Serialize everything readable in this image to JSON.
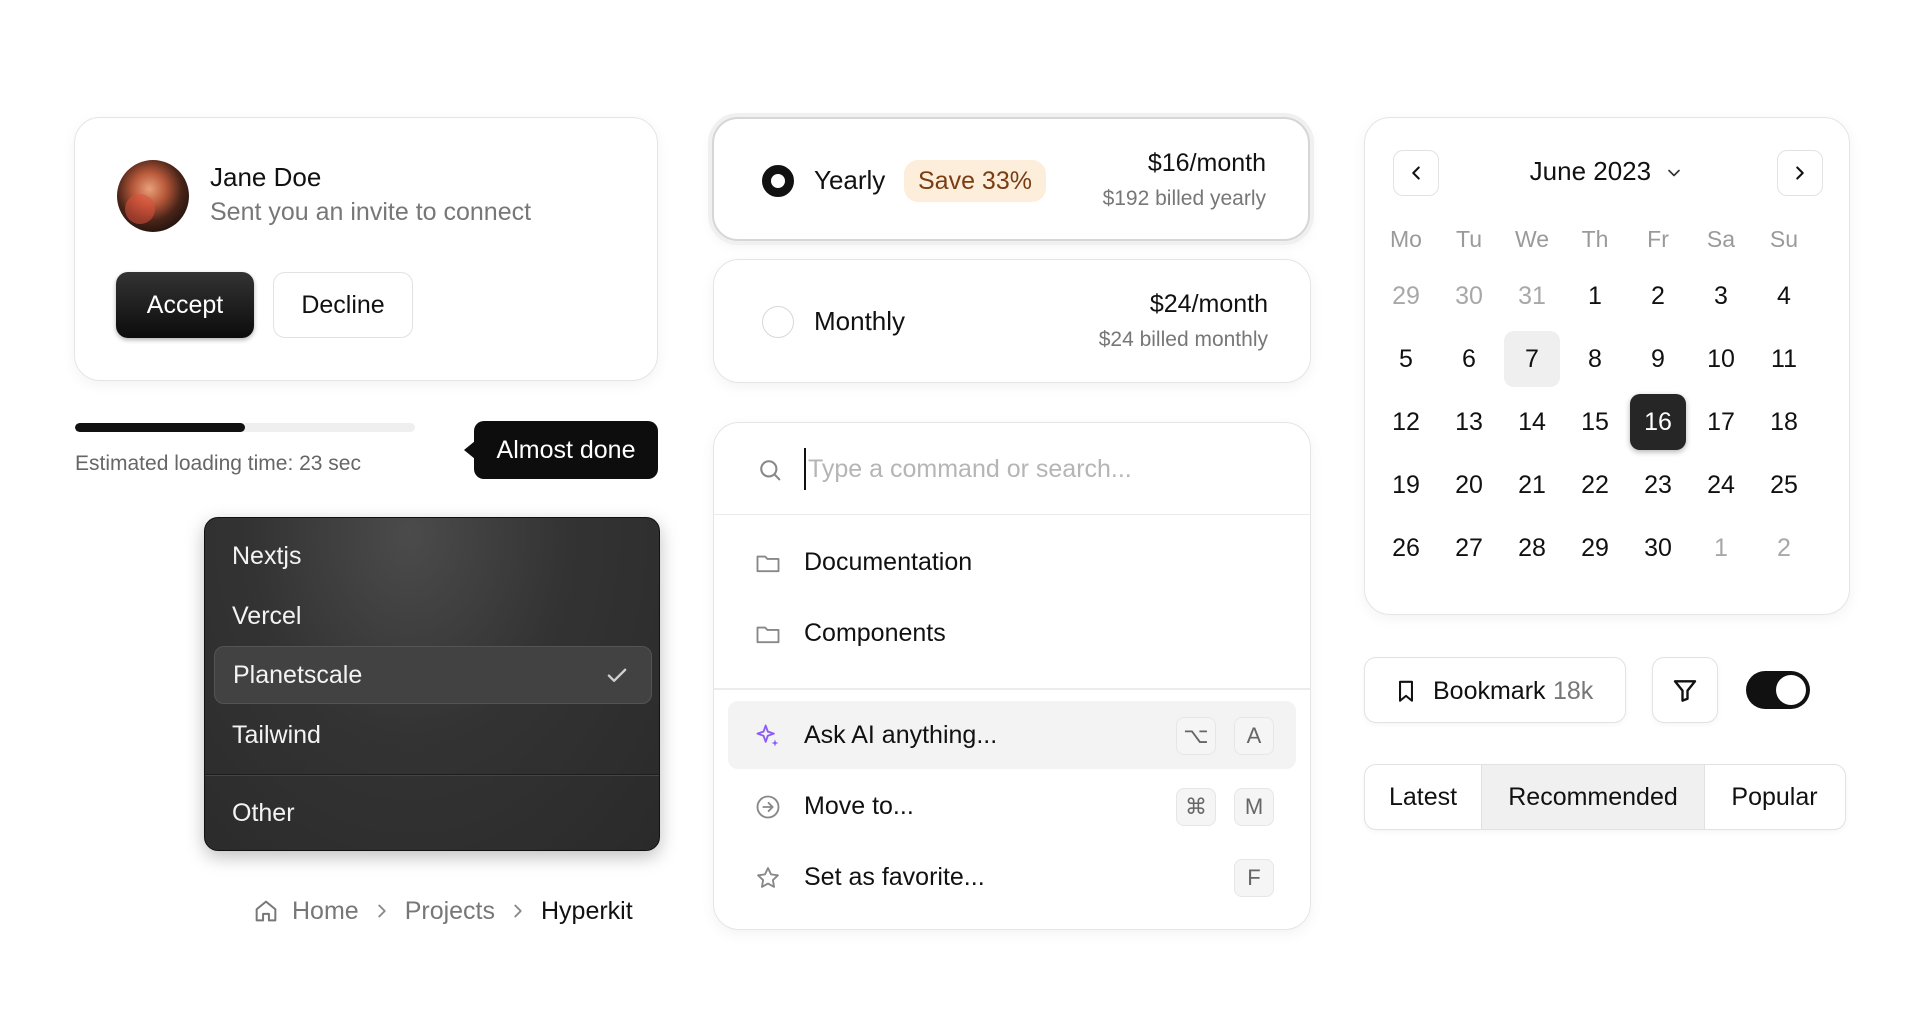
{
  "invite": {
    "name": "Jane Doe",
    "message": "Sent you an invite to connect",
    "accept_label": "Accept",
    "decline_label": "Decline"
  },
  "progress": {
    "value": 0.5,
    "text": "Estimated loading time: 23 sec",
    "tooltip": "Almost done"
  },
  "dropdown": {
    "items": [
      "Nextjs",
      "Vercel",
      "Planetscale",
      "Tailwind",
      "Other"
    ],
    "selected": "Planetscale"
  },
  "breadcrumb": {
    "items": [
      "Home",
      "Projects",
      "Hyperkit"
    ]
  },
  "plans": {
    "yearly": {
      "name": "Yearly",
      "badge": "Save 33%",
      "price": "$16",
      "per": "/month",
      "billed": "$192 billed yearly",
      "selected": true
    },
    "monthly": {
      "name": "Monthly",
      "price": "$24",
      "per": "/month",
      "billed": "$24 billed monthly",
      "selected": false
    }
  },
  "palette": {
    "placeholder": "Type a command or search...",
    "items": [
      {
        "label": "Documentation",
        "icon": "folder-icon"
      },
      {
        "label": "Components",
        "icon": "folder-icon"
      },
      {
        "label": "Ask AI anything...",
        "icon": "sparkles-icon",
        "keys": [
          "⌥",
          "A"
        ]
      },
      {
        "label": "Move to...",
        "icon": "arrow-circle-icon",
        "keys": [
          "⌘",
          "M"
        ]
      },
      {
        "label": "Set as favorite...",
        "icon": "star-icon",
        "keys": [
          "F"
        ]
      }
    ]
  },
  "calendar": {
    "title": "June 2023",
    "weekdays": [
      "Mo",
      "Tu",
      "We",
      "Th",
      "Fr",
      "Sa",
      "Su"
    ],
    "weeks": [
      [
        "29",
        "30",
        "31",
        "1",
        "2",
        "3",
        "4"
      ],
      [
        "5",
        "6",
        "7",
        "8",
        "9",
        "10",
        "11"
      ],
      [
        "12",
        "13",
        "14",
        "15",
        "16",
        "17",
        "18"
      ],
      [
        "19",
        "20",
        "21",
        "22",
        "23",
        "24",
        "25"
      ],
      [
        "26",
        "27",
        "28",
        "29",
        "30",
        "1",
        "2"
      ]
    ],
    "today": "7",
    "selected": "16"
  },
  "bookmark": {
    "label": "Bookmark",
    "count": "18k"
  },
  "toggle": {
    "on": true
  },
  "tabs": {
    "items": [
      "Latest",
      "Recommended",
      "Popular"
    ],
    "active": "Recommended"
  },
  "colors": {
    "accent": "#111111",
    "badge_bg": "#fdeedb",
    "badge_text": "#7a3d12",
    "ai_purple": "#8b5cf6"
  }
}
